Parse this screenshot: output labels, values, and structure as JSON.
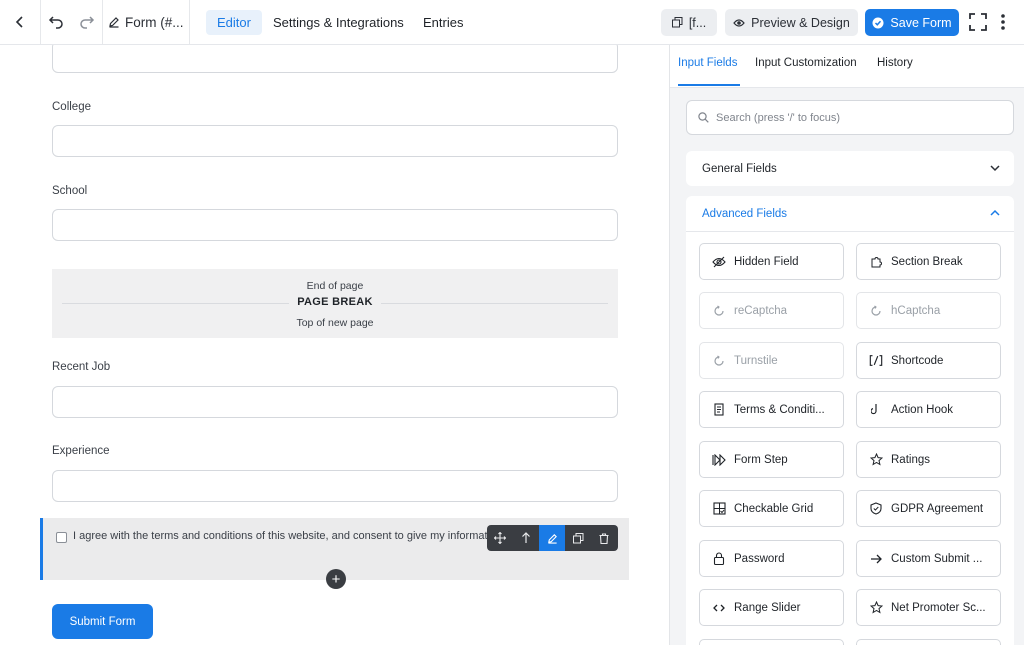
{
  "topbar": {
    "form_name": "Form (#...",
    "tabs": [
      "Editor",
      "Settings & Integrations",
      "Entries"
    ],
    "shortcode_label": "[f...",
    "preview_label": "Preview & Design",
    "save_label": "Save Form"
  },
  "editor": {
    "labels": {
      "college": "College",
      "school": "School",
      "recent_job": "Recent Job",
      "experience": "Experience"
    },
    "page_break": {
      "end": "End of page",
      "title": "PAGE BREAK",
      "top": "Top of new page"
    },
    "terms_text": "I agree with the terms and conditions of this website, and consent to give my information",
    "add_symbol": "+",
    "submit_label": "Submit Form"
  },
  "sidebar": {
    "tabs": [
      "Input Fields",
      "Input Customization",
      "History"
    ],
    "search_placeholder": "Search (press '/' to focus)",
    "general_title": "General Fields",
    "advanced_title": "Advanced Fields",
    "fields": [
      {
        "label": "Hidden Field",
        "icon": "eye-off-icon",
        "disabled": false
      },
      {
        "label": "Section Break",
        "icon": "puzzle-icon",
        "disabled": false
      },
      {
        "label": "reCaptcha",
        "icon": "captcha-icon",
        "disabled": true
      },
      {
        "label": "hCaptcha",
        "icon": "captcha-icon",
        "disabled": true
      },
      {
        "label": "Turnstile",
        "icon": "captcha-icon",
        "disabled": true
      },
      {
        "label": "Shortcode",
        "icon": "shortcode-icon",
        "disabled": false
      },
      {
        "label": "Terms & Conditi...",
        "icon": "document-icon",
        "disabled": false
      },
      {
        "label": "Action Hook",
        "icon": "hook-icon",
        "disabled": false
      },
      {
        "label": "Form Step",
        "icon": "step-forward-icon",
        "disabled": false
      },
      {
        "label": "Ratings",
        "icon": "star-icon",
        "disabled": false
      },
      {
        "label": "Checkable Grid",
        "icon": "grid-check-icon",
        "disabled": false
      },
      {
        "label": "GDPR Agreement",
        "icon": "shield-icon",
        "disabled": false
      },
      {
        "label": "Password",
        "icon": "lock-icon",
        "disabled": false
      },
      {
        "label": "Custom Submit ...",
        "icon": "arrow-right-icon",
        "disabled": false
      },
      {
        "label": "Range Slider",
        "icon": "range-icon",
        "disabled": false
      },
      {
        "label": "Net Promoter Sc...",
        "icon": "star-icon",
        "disabled": false
      }
    ]
  }
}
